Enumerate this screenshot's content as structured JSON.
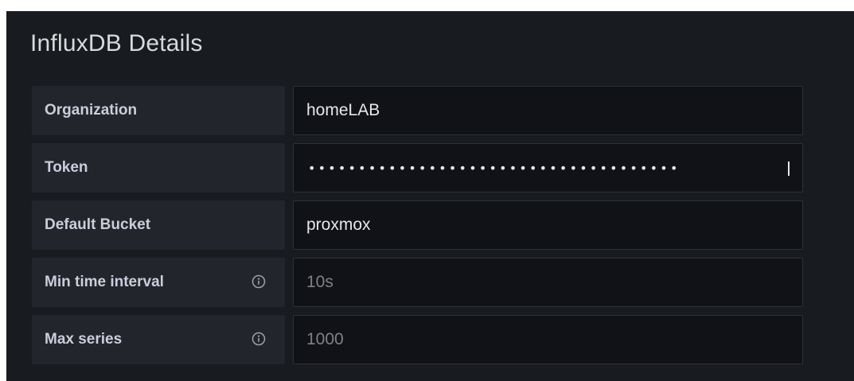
{
  "section": {
    "title": "InfluxDB Details"
  },
  "rows": [
    {
      "label": "Organization",
      "value": "homeLAB",
      "placeholder": "",
      "info": false
    },
    {
      "label": "Token",
      "value": "•••••••••••••••••••••••••••••••••••••",
      "placeholder": "",
      "info": false
    },
    {
      "label": "Default Bucket",
      "value": "proxmox",
      "placeholder": "",
      "info": false
    },
    {
      "label": "Min time interval",
      "value": "",
      "placeholder": "10s",
      "info": true
    },
    {
      "label": "Max series",
      "value": "",
      "placeholder": "1000",
      "info": true
    }
  ],
  "colors": {
    "panel_bg": "#181b1f",
    "label_bg": "#22252b",
    "input_bg": "#111217",
    "text": "#ccccdc",
    "placeholder": "#7f8186"
  }
}
